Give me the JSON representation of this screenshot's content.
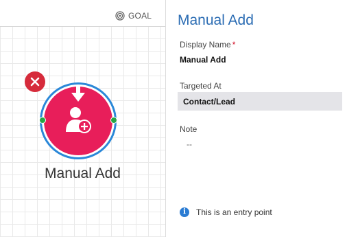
{
  "canvas": {
    "goal_label": "GOAL",
    "node": {
      "label": "Manual Add",
      "icon": "person-add-icon",
      "entry_arrow_icon": "arrow-down-icon",
      "color": "#e81e5a",
      "ring_color": "#2b88d8",
      "connector_color": "#27a544",
      "delete_icon": "close-icon",
      "delete_color": "#d62b3b"
    }
  },
  "panel": {
    "title": "Manual Add",
    "display_name": {
      "label": "Display Name",
      "required_mark": "*",
      "value": "Manual Add"
    },
    "targeted_at": {
      "label": "Targeted At",
      "value": "Contact/Lead"
    },
    "note": {
      "label": "Note",
      "value": "--"
    },
    "info": {
      "icon": "info-icon",
      "text": "This is an entry point"
    },
    "accent_color": "#2b6cb3"
  }
}
